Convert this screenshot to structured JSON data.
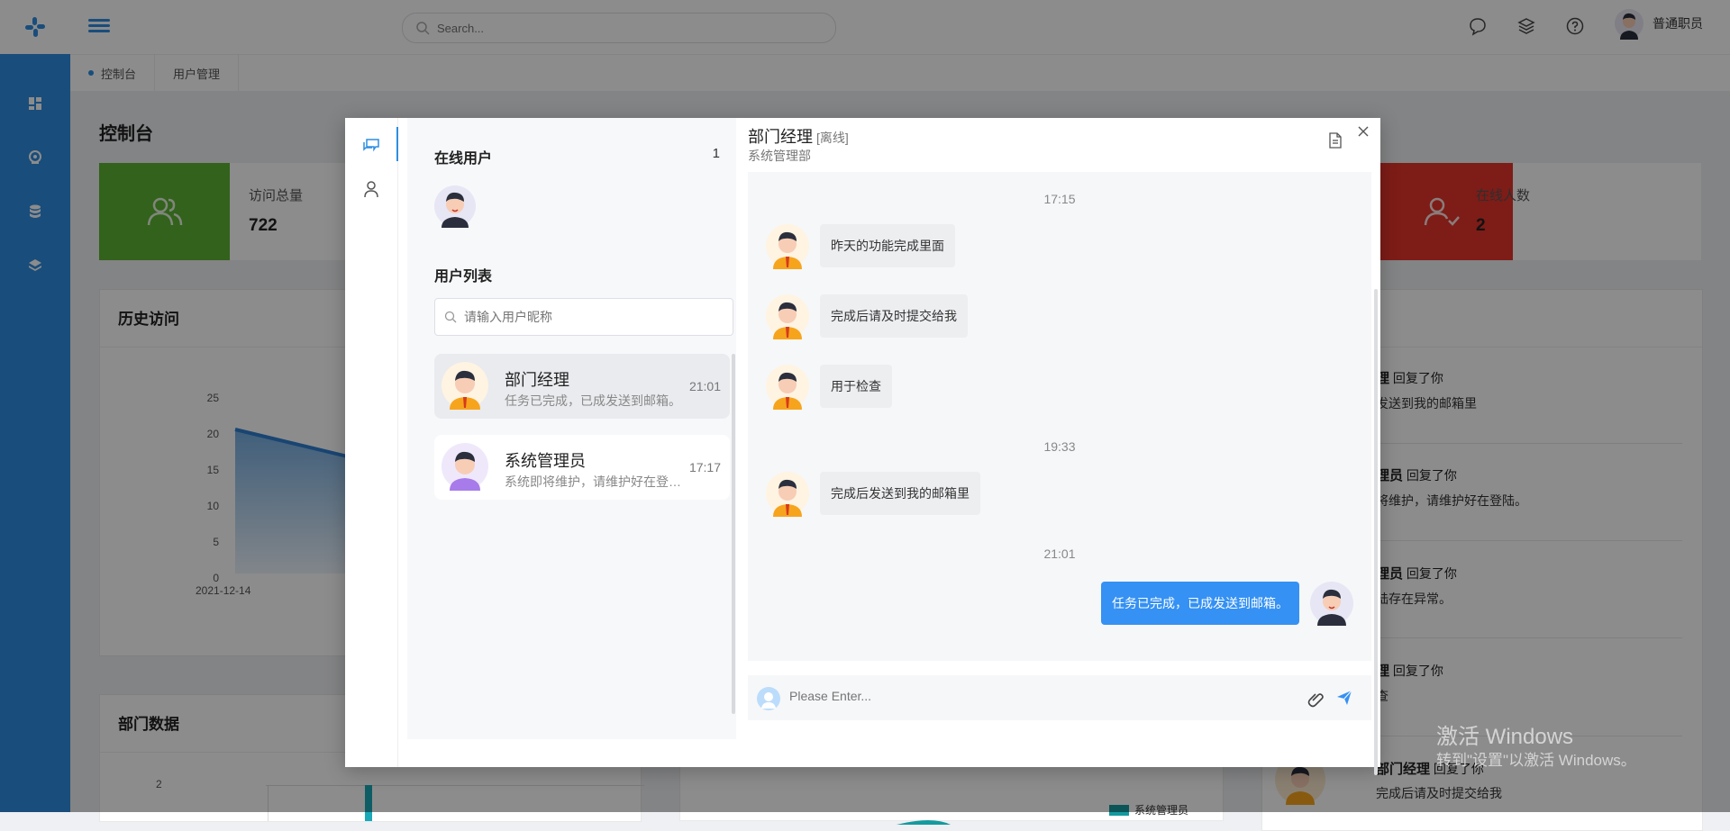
{
  "topbar": {
    "search_placeholder": "Search...",
    "user_name": "普通职员"
  },
  "breadcrumb": [
    "控制台",
    "用户管理"
  ],
  "page": {
    "title": "控制台",
    "stats": [
      {
        "label": "访问总量",
        "value": "722",
        "color": "#5bb332"
      },
      {
        "label": "在线人数",
        "value": "2",
        "color": "#e6332a"
      }
    ],
    "history_title": "历史访问",
    "history_chart": {
      "yticks": [
        "25",
        "20",
        "15",
        "10",
        "5",
        "0"
      ],
      "first_date": "2021-12-14"
    },
    "dept_title": "部门数据",
    "dept_tick": "2",
    "dept_legend": "系统管理员",
    "replies": [
      {
        "name": "理",
        "action": "回复了你",
        "text": "发送到我的邮箱里"
      },
      {
        "name": "理员",
        "action": "回复了你",
        "text": "将维护，请维护好在登陆。"
      },
      {
        "name": "理员",
        "action": "回复了你",
        "text": "陆存在异常。"
      },
      {
        "name": "理",
        "action": "回复了你",
        "text": "查"
      },
      {
        "name": "部门经理",
        "action": "回复了你",
        "text": "完成后请及时提交给我"
      }
    ],
    "watermark_line1": "激活 Windows",
    "watermark_line2": "转到\"设置\"以激活 Windows。"
  },
  "chat": {
    "online_title": "在线用户",
    "online_count": "1",
    "user_list_title": "用户列表",
    "user_search_placeholder": "请输入用户昵称",
    "conversations": [
      {
        "name": "部门经理",
        "preview": "任务已完成，已成发送到邮箱。",
        "time": "21:01"
      },
      {
        "name": "系统管理员",
        "preview": "系统即将维护，请维护好在登陆。",
        "time": "17:17"
      }
    ],
    "header": {
      "name": "部门经理",
      "status": "[离线]",
      "dept": "系统管理部"
    },
    "timestamps": [
      "17:15",
      "19:33",
      "21:01"
    ],
    "messages": [
      {
        "text": "昨天的功能完成里面"
      },
      {
        "text": "完成后请及时提交给我"
      },
      {
        "text": "用于检查"
      },
      {
        "text": "完成后发送到我的邮箱里"
      }
    ],
    "my_message": "任务已完成，已成发送到邮箱。",
    "composer_placeholder": "Please Enter..."
  }
}
